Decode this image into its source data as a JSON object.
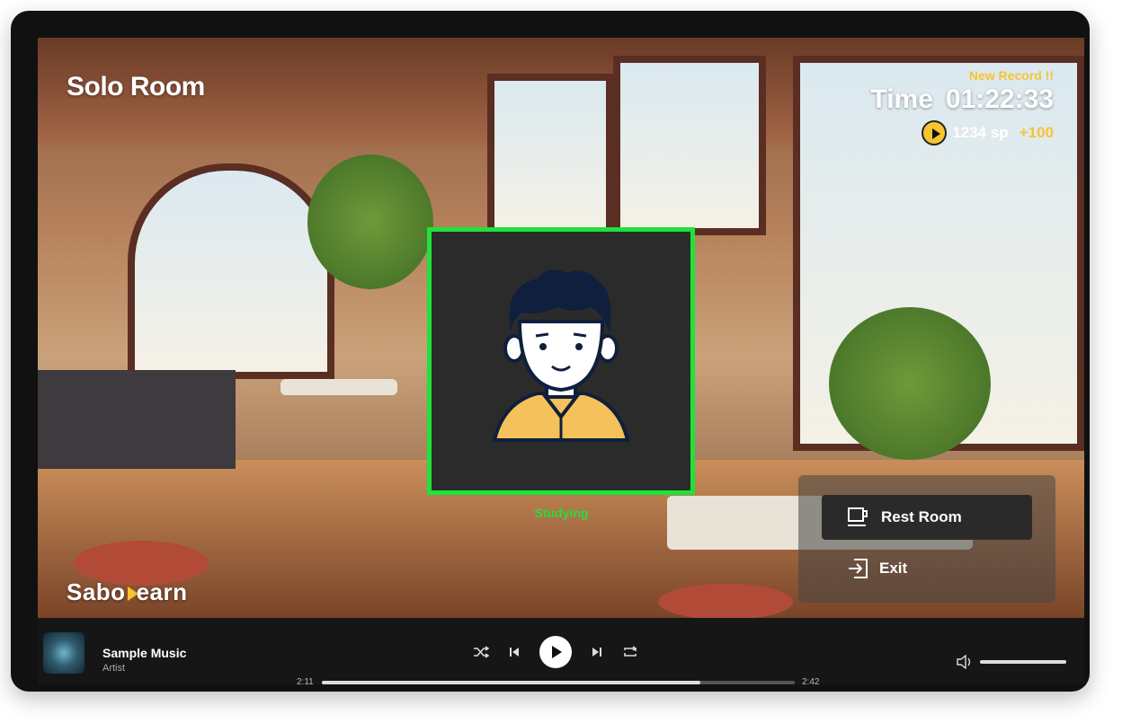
{
  "room": {
    "title": "Solo Room"
  },
  "timer": {
    "new_record": "New Record !!",
    "label": "Time",
    "value": "01:22:33"
  },
  "points": {
    "amount": "1234 sp",
    "bonus": "+100"
  },
  "avatar": {
    "status": "Studying",
    "border_color": "#1fe23a"
  },
  "actions": {
    "rest_room": "Rest Room",
    "exit": "Exit"
  },
  "brand": {
    "logo_prefix": "Sabo",
    "logo_suffix": "earn"
  },
  "player": {
    "track_title": "Sample Music",
    "artist": "Artist",
    "current_time": "2:11",
    "total_time": "2:42",
    "progress": 0.8,
    "volume": 1.0
  },
  "colors": {
    "accent": "#f6c431",
    "status": "#2adb3c"
  }
}
